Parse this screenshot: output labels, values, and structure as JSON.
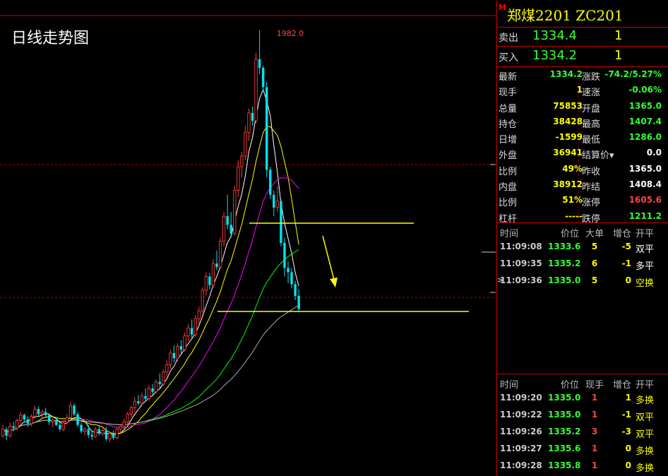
{
  "chart_title": "日线走势图",
  "chart_data": {
    "type": "candlestick",
    "high_label": "1982.0",
    "candles": [
      [
        1040,
        1065,
        1035,
        1055
      ],
      [
        1055,
        1060,
        1030,
        1040
      ],
      [
        1040,
        1070,
        1035,
        1062
      ],
      [
        1062,
        1072,
        1050,
        1058
      ],
      [
        1058,
        1080,
        1052,
        1075
      ],
      [
        1075,
        1095,
        1068,
        1088
      ],
      [
        1088,
        1092,
        1070,
        1078
      ],
      [
        1078,
        1085,
        1060,
        1068
      ],
      [
        1068,
        1090,
        1062,
        1085
      ],
      [
        1085,
        1110,
        1080,
        1102
      ],
      [
        1102,
        1108,
        1085,
        1090
      ],
      [
        1090,
        1100,
        1078,
        1095
      ],
      [
        1095,
        1105,
        1082,
        1088
      ],
      [
        1088,
        1092,
        1065,
        1072
      ],
      [
        1072,
        1080,
        1060,
        1076
      ],
      [
        1076,
        1082,
        1062,
        1065
      ],
      [
        1065,
        1070,
        1050,
        1055
      ],
      [
        1055,
        1075,
        1050,
        1070
      ],
      [
        1070,
        1090,
        1065,
        1082
      ],
      [
        1082,
        1118,
        1078,
        1110
      ],
      [
        1110,
        1115,
        1085,
        1090
      ],
      [
        1090,
        1095,
        1060,
        1065
      ],
      [
        1065,
        1070,
        1045,
        1050
      ],
      [
        1050,
        1060,
        1040,
        1055
      ],
      [
        1055,
        1065,
        1035,
        1042
      ],
      [
        1042,
        1052,
        1030,
        1038
      ],
      [
        1038,
        1060,
        1035,
        1055
      ],
      [
        1055,
        1062,
        1040,
        1045
      ],
      [
        1045,
        1058,
        1038,
        1052
      ],
      [
        1052,
        1060,
        1028,
        1032
      ],
      [
        1032,
        1048,
        1025,
        1045
      ],
      [
        1045,
        1052,
        1030,
        1035
      ],
      [
        1035,
        1060,
        1032,
        1055
      ],
      [
        1055,
        1068,
        1048,
        1062
      ],
      [
        1062,
        1080,
        1055,
        1072
      ],
      [
        1072,
        1095,
        1065,
        1090
      ],
      [
        1090,
        1110,
        1082,
        1105
      ],
      [
        1105,
        1130,
        1095,
        1120
      ],
      [
        1120,
        1135,
        1110,
        1115
      ],
      [
        1115,
        1140,
        1108,
        1132
      ],
      [
        1132,
        1150,
        1120,
        1126
      ],
      [
        1126,
        1158,
        1120,
        1150
      ],
      [
        1150,
        1160,
        1135,
        1142
      ],
      [
        1142,
        1170,
        1138,
        1165
      ],
      [
        1165,
        1185,
        1150,
        1160
      ],
      [
        1160,
        1195,
        1155,
        1188
      ],
      [
        1188,
        1215,
        1178,
        1205
      ],
      [
        1205,
        1240,
        1195,
        1232
      ],
      [
        1232,
        1250,
        1210,
        1220
      ],
      [
        1220,
        1255,
        1212,
        1248
      ],
      [
        1248,
        1262,
        1230,
        1240
      ],
      [
        1240,
        1280,
        1235,
        1272
      ],
      [
        1272,
        1300,
        1260,
        1290
      ],
      [
        1290,
        1310,
        1265,
        1275
      ],
      [
        1275,
        1320,
        1270,
        1312
      ],
      [
        1312,
        1340,
        1300,
        1330
      ],
      [
        1330,
        1385,
        1325,
        1378
      ],
      [
        1378,
        1420,
        1365,
        1410
      ],
      [
        1410,
        1418,
        1380,
        1390
      ],
      [
        1390,
        1450,
        1385,
        1440
      ],
      [
        1440,
        1470,
        1425,
        1432
      ],
      [
        1432,
        1500,
        1428,
        1492
      ],
      [
        1492,
        1560,
        1480,
        1550
      ],
      [
        1550,
        1600,
        1520,
        1530
      ],
      [
        1530,
        1560,
        1500,
        1510
      ],
      [
        1510,
        1620,
        1505,
        1610
      ],
      [
        1610,
        1680,
        1595,
        1665
      ],
      [
        1665,
        1700,
        1640,
        1690
      ],
      [
        1690,
        1760,
        1680,
        1745
      ],
      [
        1745,
        1800,
        1725,
        1790
      ],
      [
        1790,
        1805,
        1760,
        1772
      ],
      [
        1772,
        1930,
        1765,
        1915
      ],
      [
        1915,
        1982,
        1880,
        1895
      ],
      [
        1895,
        1900,
        1840,
        1850
      ],
      [
        1850,
        1862,
        1640,
        1658
      ],
      [
        1658,
        1665,
        1590,
        1600
      ],
      [
        1600,
        1610,
        1550,
        1570
      ],
      [
        1570,
        1620,
        1560,
        1585
      ],
      [
        1585,
        1590,
        1480,
        1488
      ],
      [
        1488,
        1500,
        1410,
        1430
      ],
      [
        1430,
        1445,
        1395,
        1420
      ],
      [
        1420,
        1430,
        1382,
        1392
      ],
      [
        1392,
        1400,
        1355,
        1365
      ],
      [
        1365,
        1380,
        1330,
        1334.2
      ]
    ],
    "ma_colors": [
      "#ffffff",
      "#ffff00",
      "#ff00ff",
      "#00ff00",
      "#aaaaaa"
    ],
    "ma_periods": [
      5,
      10,
      20,
      40,
      60
    ]
  },
  "contract": {
    "flag": "M",
    "name": "郑煤2201  ZC201"
  },
  "sell": {
    "label": "卖出",
    "price": "1334.4",
    "volume": "1"
  },
  "buy": {
    "label": "买入",
    "price": "1334.2",
    "volume": "1"
  },
  "quote_rows": [
    {
      "l1": "最新",
      "v1": "1334.2",
      "c1": "#3f3",
      "l2": "涨跌",
      "v2": "-74.2/5.27%",
      "c2": "#3f3"
    },
    {
      "l1": "现手",
      "v1": "1",
      "c1": "#ff0",
      "l2": "速涨",
      "v2": "-0.06%",
      "c2": "#3f3"
    },
    {
      "l1": "总量",
      "v1": "75853",
      "c1": "#ff0",
      "l2": "开盘",
      "v2": "1365.0",
      "c2": "#3f3"
    },
    {
      "l1": "持仓",
      "v1": "38428",
      "c1": "#ff0",
      "l2": "最高",
      "v2": "1407.4",
      "c2": "#3f3"
    },
    {
      "l1": "日增",
      "v1": "-1599",
      "c1": "#ff0",
      "l2": "最低",
      "v2": "1286.0",
      "c2": "#3f3"
    },
    {
      "l1": "外盘",
      "v1": "36941",
      "c1": "#ff0",
      "l2": "结算价▾",
      "v2": "0.0",
      "c2": "#fff"
    },
    {
      "l1": "比例",
      "v1": "49%",
      "c1": "#ff0",
      "l2": "昨收",
      "v2": "1365.0",
      "c2": "#fff"
    },
    {
      "l1": "内盘",
      "v1": "38912",
      "c1": "#ff0",
      "l2": "昨结",
      "v2": "1408.4",
      "c2": "#fff"
    },
    {
      "l1": "比例",
      "v1": "51%",
      "c1": "#ff0",
      "l2": "涨停",
      "v2": "1605.6",
      "c2": "#f44"
    },
    {
      "l1": "杠杆",
      "v1": "-----",
      "c1": "#ff0",
      "l2": "跌停",
      "v2": "1211.2",
      "c2": "#3f3"
    }
  ],
  "big_orders": {
    "headers": [
      "时间",
      "价位",
      "大单",
      "增仓",
      "开平"
    ],
    "rows": [
      {
        "time": "11:09:08",
        "price": "1333.6",
        "qty": "5",
        "chg": "-5",
        "type": "双平",
        "typecolor": "#fff",
        "mark": ""
      },
      {
        "time": "11:09:35",
        "price": "1335.2",
        "qty": "6",
        "chg": "-1",
        "type": "多平",
        "typecolor": "#fff",
        "mark": ""
      },
      {
        "time": "11:09:36",
        "price": "1335.0",
        "qty": "5",
        "chg": "0",
        "type": "空换",
        "typecolor": "#ff0",
        "mark": ">"
      }
    ]
  },
  "ticks": {
    "headers": [
      "时间",
      "价位",
      "现手",
      "增仓",
      "开平"
    ],
    "rows": [
      {
        "time": "11:09:20",
        "price": "1335.0",
        "qty": "1",
        "chg": "1",
        "type": "多换",
        "typecolor": "#ff0"
      },
      {
        "time": "11:09:22",
        "price": "1335.0",
        "qty": "1",
        "chg": "-1",
        "type": "双平",
        "typecolor": "#ff0"
      },
      {
        "time": "11:09:26",
        "price": "1335.2",
        "qty": "3",
        "chg": "-3",
        "type": "双平",
        "typecolor": "#ff0"
      },
      {
        "time": "11:09:27",
        "price": "1335.6",
        "qty": "1",
        "chg": "0",
        "type": "多换",
        "typecolor": "#ff0"
      },
      {
        "time": "11:09:28",
        "price": "1335.8",
        "qty": "1",
        "chg": "0",
        "type": "多换",
        "typecolor": "#ff0"
      }
    ]
  }
}
